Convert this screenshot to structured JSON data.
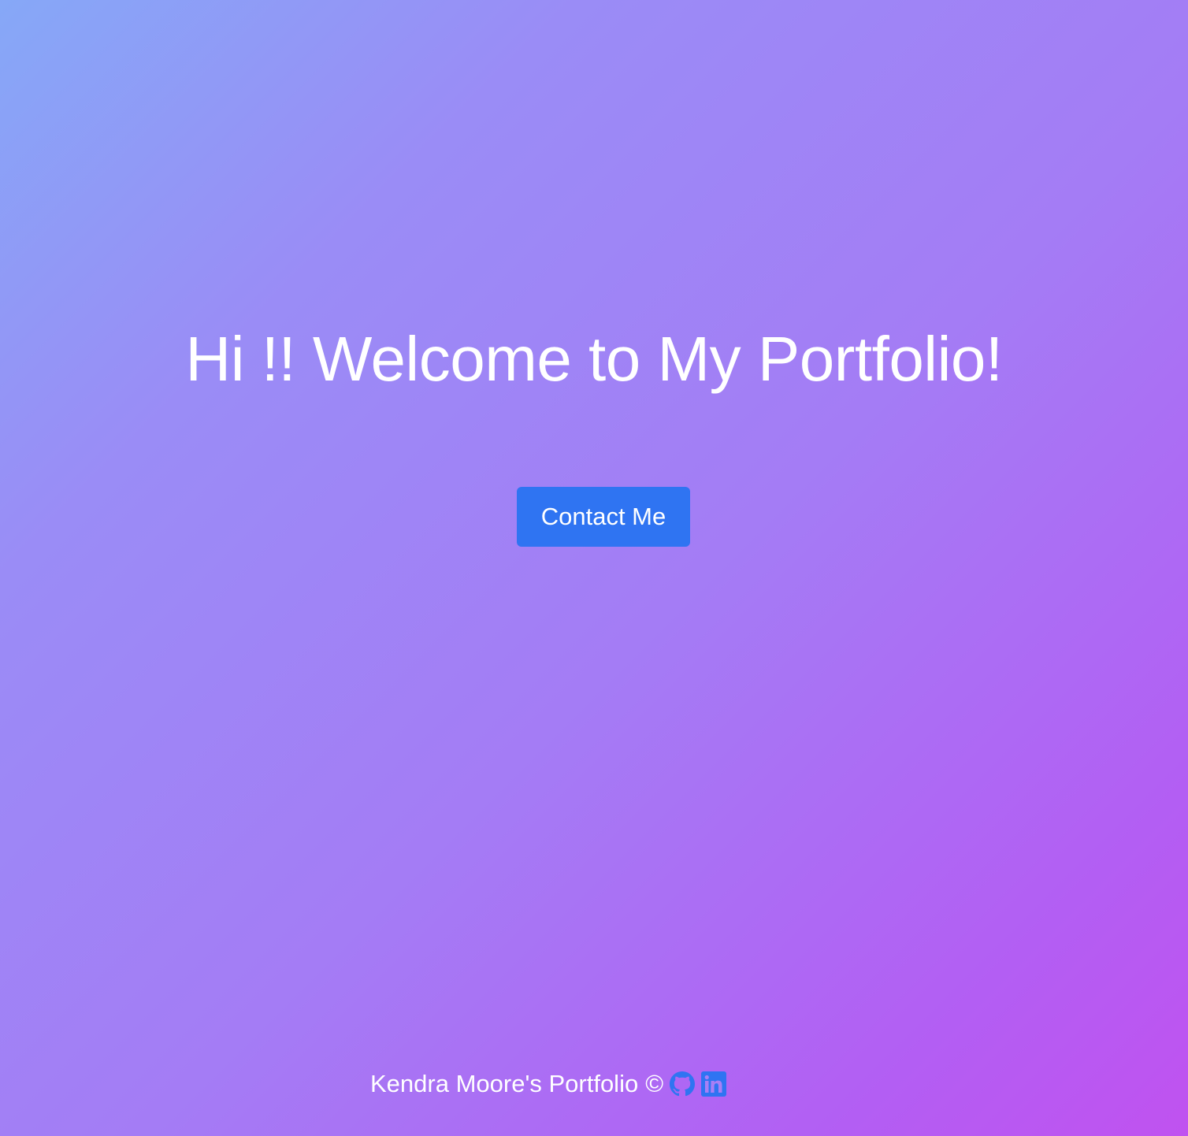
{
  "hero": {
    "title": "Hi !! Welcome to My Portfolio!"
  },
  "contact_button": {
    "label": "Contact Me"
  },
  "footer": {
    "text": "Kendra Moore's Portfolio",
    "copyright_symbol": "©",
    "links": [
      {
        "icon": "github-icon",
        "color": "#2f74f2"
      },
      {
        "icon": "linkedin-icon",
        "color": "#2f74f2"
      }
    ]
  },
  "colors": {
    "background_start": "#86a8f7",
    "background_end": "#c052f0",
    "button": "#2f74f2",
    "text": "#ffffff"
  }
}
